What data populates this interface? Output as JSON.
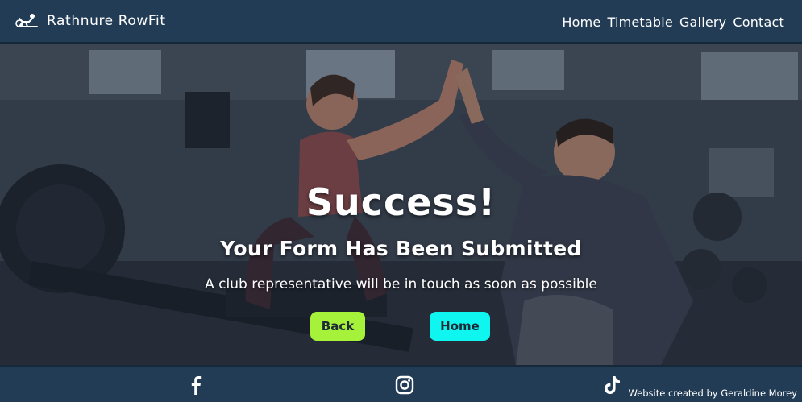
{
  "navbar": {
    "brand_name": "Rathnure RowFit",
    "links": [
      {
        "label": "Home"
      },
      {
        "label": "Timetable"
      },
      {
        "label": "Gallery"
      },
      {
        "label": "Contact"
      }
    ]
  },
  "hero": {
    "headline": "Success!",
    "subheadline": "Your Form Has Been Submitted",
    "message": "A club representative will be in touch as soon as possible",
    "buttons": {
      "back_label": "Back",
      "home_label": "Home"
    }
  },
  "footer": {
    "social_icons": [
      "facebook-icon",
      "instagram-icon",
      "tiktok-icon"
    ],
    "credit": "Website created by Geraldine Morey"
  },
  "colors": {
    "nav_background": "#223c56",
    "back_button": "#a6f23b",
    "home_button": "#0ff5f0",
    "text": "#ffffff"
  }
}
